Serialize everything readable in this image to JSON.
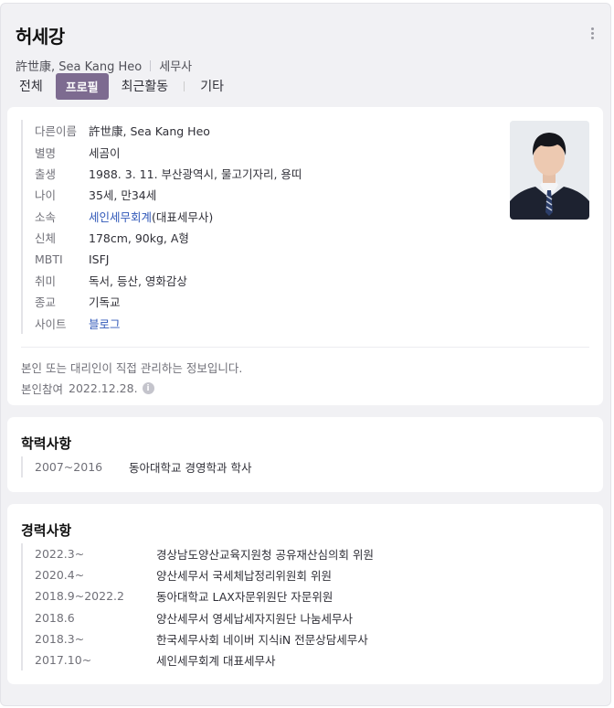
{
  "profile": {
    "name": "허세강",
    "hanja_and_english": "許世康, Sea Kang Heo",
    "occupation": "세무사"
  },
  "tabs": [
    {
      "label": "전체",
      "active": false
    },
    {
      "label": "프로필",
      "active": true
    },
    {
      "label": "최근활동",
      "active": false
    },
    {
      "label": "기타",
      "active": false
    }
  ],
  "info": {
    "rows": [
      {
        "key": "다른이름",
        "value": "許世康, Sea Kang Heo"
      },
      {
        "key": "별명",
        "value": "세곰이"
      },
      {
        "key": "출생",
        "value": "1988. 3. 11. 부산광역시, 물고기자리, 용띠"
      },
      {
        "key": "나이",
        "value": "35세, 만34세"
      },
      {
        "key": "소속",
        "link": "세인세무회계",
        "suffix": "(대표세무사)"
      },
      {
        "key": "신체",
        "value": "178cm, 90kg, A형"
      },
      {
        "key": "MBTI",
        "value": "ISFJ"
      },
      {
        "key": "취미",
        "value": "독서, 등산, 영화감상"
      },
      {
        "key": "종교",
        "value": "기독교"
      },
      {
        "key": "사이트",
        "link": "블로그"
      }
    ],
    "notice": "본인 또는 대리인이 직접 관리하는 정보입니다.",
    "joined_label": "본인참여",
    "joined_date": "2022.12.28.",
    "info_icon_glyph": "i"
  },
  "education": {
    "title": "학력사항",
    "rows": [
      {
        "period": "2007~2016",
        "text": "동아대학교 경영학과 학사"
      }
    ]
  },
  "career": {
    "title": "경력사항",
    "rows": [
      {
        "period": "2022.3~",
        "text": "경상남도양산교육지원청 공유재산심의회 위원"
      },
      {
        "period": "2020.4~",
        "text": "양산세무서 국세체납정리위원회 위원"
      },
      {
        "period": "2018.9~2022.2",
        "text": "동아대학교 LAX자문위원단 자문위원"
      },
      {
        "period": "2018.6",
        "text": "양산세무서 영세납세자지원단 나눔세무사"
      },
      {
        "period": "2018.3~",
        "text": "한국세무사회 네이버 지식iN 전문상담세무사"
      },
      {
        "period": "2017.10~",
        "text": "세인세무회계 대표세무사"
      }
    ]
  },
  "colors": {
    "accent": "#7d6b90",
    "link": "#2f57b8",
    "panel_bg": "#f1f1f4"
  }
}
